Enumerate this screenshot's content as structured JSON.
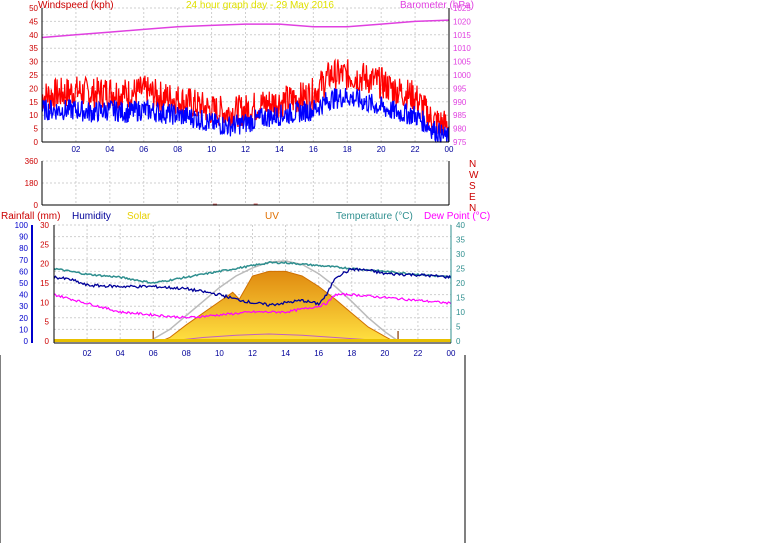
{
  "colors": {
    "wind": "#ff0000",
    "gust": "#ff0000",
    "avg": "#0000ff",
    "baro": "#e040e0",
    "title": "#e0e000",
    "humidity": "#000099",
    "temp": "#2f8f8f",
    "dew": "#ff00ff",
    "solar": "#e8d000",
    "uv": "#e07000",
    "rain": "#cc0000",
    "dir": "#cc0000",
    "grid": "#cfcfcf",
    "frame": "#000000"
  },
  "top": {
    "title": "24 hour graph day - 29 May 2016",
    "left_label": "Windspeed (kph)",
    "right_label": "Barometer (hPa)",
    "left_ticks": [
      "0",
      "5",
      "10",
      "15",
      "20",
      "25",
      "30",
      "35",
      "40",
      "45",
      "50"
    ],
    "right_ticks": [
      "975",
      "980",
      "985",
      "990",
      "995",
      "1000",
      "1005",
      "1010",
      "1015",
      "1020",
      "1025"
    ],
    "x_ticks": [
      "02",
      "04",
      "06",
      "08",
      "10",
      "12",
      "14",
      "16",
      "18",
      "20",
      "22",
      "00"
    ]
  },
  "mid": {
    "left_ticks": [
      "0",
      "180",
      "360"
    ],
    "dir_letters": [
      "N",
      "W",
      "S",
      "E",
      "N"
    ]
  },
  "bottom": {
    "rain_label": "Rainfall (mm)",
    "humidity_label": "Humidity",
    "solar_label": "Solar",
    "uv_label": "UV",
    "temp_label": "Temperature (°C)",
    "dew_label": "Dew Point (°C)",
    "humidity_ticks": [
      "0",
      "10",
      "20",
      "30",
      "40",
      "50",
      "60",
      "70",
      "80",
      "90",
      "100"
    ],
    "rain_ticks": [
      "0",
      "5",
      "10",
      "15",
      "20",
      "25",
      "30"
    ],
    "temp_ticks": [
      "0",
      "5",
      "10",
      "15",
      "20",
      "25",
      "30",
      "35",
      "40"
    ],
    "x_ticks": [
      "02",
      "04",
      "06",
      "08",
      "10",
      "12",
      "14",
      "16",
      "18",
      "20",
      "22",
      "00"
    ]
  },
  "chart_data": [
    {
      "type": "line",
      "x_unit": "hour",
      "xlim": [
        0,
        24
      ],
      "series": [
        {
          "axis": "left",
          "values": [
            [
              0,
              17
            ],
            [
              1,
              18
            ],
            [
              2,
              19
            ],
            [
              3,
              18
            ],
            [
              4,
              19
            ],
            [
              5,
              18
            ],
            [
              6,
              19
            ],
            [
              7,
              17
            ],
            [
              8,
              16
            ],
            [
              9,
              14
            ],
            [
              10,
              12
            ],
            [
              11,
              11
            ],
            [
              12,
              12
            ],
            [
              13,
              14
            ],
            [
              14,
              15
            ],
            [
              15,
              16
            ],
            [
              16,
              18
            ],
            [
              17,
              25
            ],
            [
              18,
              25
            ],
            [
              19,
              24
            ],
            [
              20,
              22
            ],
            [
              21,
              19
            ],
            [
              22,
              17
            ],
            [
              23,
              8
            ],
            [
              24,
              6
            ]
          ]
        },
        {
          "axis": "left",
          "values": [
            [
              0,
              12
            ],
            [
              1,
              12
            ],
            [
              2,
              12
            ],
            [
              3,
              11
            ],
            [
              4,
              12
            ],
            [
              5,
              11
            ],
            [
              6,
              12
            ],
            [
              7,
              11
            ],
            [
              8,
              10
            ],
            [
              9,
              9
            ],
            [
              10,
              7
            ],
            [
              11,
              6
            ],
            [
              12,
              7
            ],
            [
              13,
              9
            ],
            [
              14,
              10
            ],
            [
              15,
              11
            ],
            [
              16,
              12
            ],
            [
              17,
              16
            ],
            [
              18,
              17
            ],
            [
              19,
              15
            ],
            [
              20,
              13
            ],
            [
              21,
              11
            ],
            [
              22,
              10
            ],
            [
              23,
              5
            ],
            [
              24,
              1
            ]
          ]
        },
        {
          "axis": "right",
          "values": [
            [
              0,
              1014
            ],
            [
              2,
              1015
            ],
            [
              4,
              1016
            ],
            [
              6,
              1017
            ],
            [
              8,
              1018
            ],
            [
              10,
              1018.5
            ],
            [
              12,
              1019
            ],
            [
              14,
              1019
            ],
            [
              16,
              1018
            ],
            [
              18,
              1018
            ],
            [
              20,
              1019
            ],
            [
              22,
              1020
            ],
            [
              24,
              1020.5
            ]
          ]
        }
      ],
      "ylim": [
        0,
        50
      ],
      "y2lim": [
        975,
        1025
      ]
    },
    {
      "type": "scatter",
      "x_unit": "hour",
      "xlim": [
        0,
        24
      ],
      "ylim": [
        0,
        360
      ],
      "series": [
        {
          "values": [
            [
              10.2,
              3
            ],
            [
              12.6,
              4
            ]
          ]
        }
      ]
    },
    {
      "type": "area",
      "x_unit": "hour",
      "xlim": [
        0,
        24
      ],
      "series": [
        {
          "axis": "left",
          "values": [
            [
              0,
              55
            ],
            [
              1,
              53
            ],
            [
              2,
              48
            ],
            [
              4,
              47
            ],
            [
              6,
              47
            ],
            [
              8,
              45
            ],
            [
              10,
              40
            ],
            [
              11,
              36
            ],
            [
              12,
              33
            ],
            [
              13,
              31
            ],
            [
              14,
              33
            ],
            [
              15,
              35
            ],
            [
              16,
              32
            ],
            [
              16.5,
              40
            ],
            [
              17,
              55
            ],
            [
              18,
              62
            ],
            [
              19,
              61
            ],
            [
              20,
              58
            ],
            [
              22,
              57
            ],
            [
              24,
              55
            ]
          ]
        },
        {
          "axis": "right",
          "values": [
            [
              0,
              25
            ],
            [
              2,
              23
            ],
            [
              4,
              22
            ],
            [
              6,
              20
            ],
            [
              8,
              22
            ],
            [
              10,
              24
            ],
            [
              12,
              26
            ],
            [
              13,
              27
            ],
            [
              14,
              27
            ],
            [
              16,
              26
            ],
            [
              18,
              25
            ],
            [
              20,
              24
            ],
            [
              22,
              23
            ],
            [
              24,
              22
            ]
          ]
        },
        {
          "axis": "right",
          "values": [
            [
              0,
              16
            ],
            [
              2,
              13
            ],
            [
              4,
              10
            ],
            [
              6,
              9
            ],
            [
              8,
              8
            ],
            [
              10,
              9
            ],
            [
              12,
              10
            ],
            [
              14,
              10
            ],
            [
              15,
              11
            ],
            [
              16,
              12
            ],
            [
              16.5,
              13
            ],
            [
              17,
              16
            ],
            [
              18,
              16
            ],
            [
              20,
              15
            ],
            [
              22,
              14
            ],
            [
              24,
              13
            ]
          ]
        },
        {
          "axis": "left",
          "values": [
            [
              6.5,
              0
            ],
            [
              7,
              3
            ],
            [
              8,
              14
            ],
            [
              9,
              24
            ],
            [
              10,
              34
            ],
            [
              10.8,
              42
            ],
            [
              11.2,
              36
            ],
            [
              12,
              56
            ],
            [
              13,
              60
            ],
            [
              14,
              60
            ],
            [
              15,
              56
            ],
            [
              16,
              47
            ],
            [
              17,
              36
            ],
            [
              18,
              24
            ],
            [
              19,
              12
            ],
            [
              20,
              4
            ],
            [
              20.5,
              0
            ]
          ]
        },
        {
          "axis": "left",
          "values": [
            [
              5.8,
              0
            ],
            [
              7,
              10
            ],
            [
              8,
              22
            ],
            [
              9,
              34
            ],
            [
              10,
              46
            ],
            [
              11,
              56
            ],
            [
              12,
              63
            ],
            [
              13,
              68
            ],
            [
              14,
              69
            ],
            [
              15,
              66
            ],
            [
              16,
              58
            ],
            [
              17,
              47
            ],
            [
              18,
              34
            ],
            [
              19,
              20
            ],
            [
              20,
              8
            ],
            [
              20.8,
              0
            ]
          ]
        },
        {
          "axis": "left",
          "values": [
            [
              7,
              0
            ],
            [
              9,
              3
            ],
            [
              11,
              5
            ],
            [
              13,
              6
            ],
            [
              15,
              5
            ],
            [
              17,
              3
            ],
            [
              19,
              1
            ],
            [
              20,
              0
            ]
          ]
        }
      ],
      "ylim": [
        0,
        100
      ],
      "y2lim": [
        0,
        40
      ]
    }
  ]
}
